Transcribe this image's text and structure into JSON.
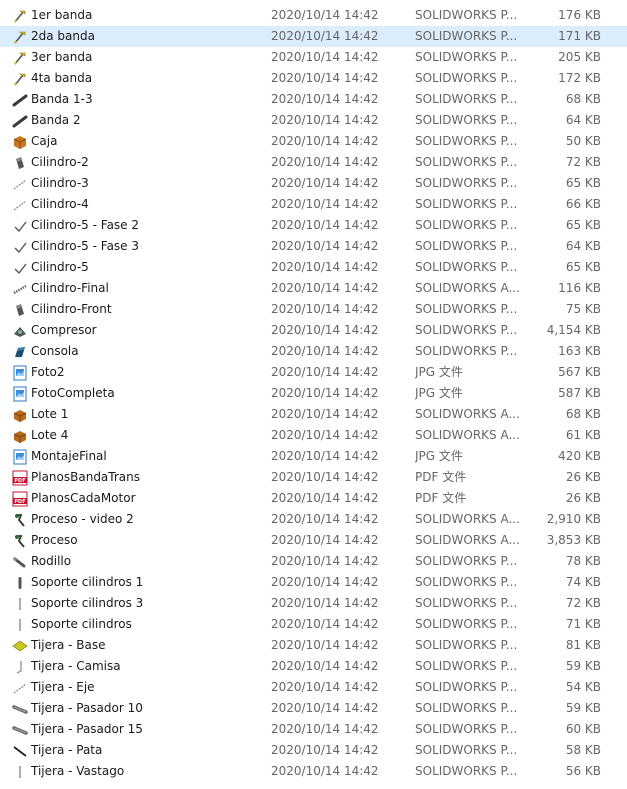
{
  "files": [
    {
      "name": "1er banda",
      "date": "2020/10/14 14:42",
      "type": "SOLIDWORKS P...",
      "size": "176 KB",
      "icon": "part-yellow-icon"
    },
    {
      "name": "2da banda",
      "date": "2020/10/14 14:42",
      "type": "SOLIDWORKS P...",
      "size": "171 KB",
      "icon": "part-yellow-icon",
      "selected": true
    },
    {
      "name": "3er banda",
      "date": "2020/10/14 14:42",
      "type": "SOLIDWORKS P...",
      "size": "205 KB",
      "icon": "part-yellow-icon"
    },
    {
      "name": "4ta banda",
      "date": "2020/10/14 14:42",
      "type": "SOLIDWORKS P...",
      "size": "172 KB",
      "icon": "part-yellow-icon"
    },
    {
      "name": "Banda 1-3",
      "date": "2020/10/14 14:42",
      "type": "SOLIDWORKS P...",
      "size": "68 KB",
      "icon": "part-bar-icon"
    },
    {
      "name": "Banda 2",
      "date": "2020/10/14 14:42",
      "type": "SOLIDWORKS P...",
      "size": "64 KB",
      "icon": "part-bar-icon"
    },
    {
      "name": "Caja",
      "date": "2020/10/14 14:42",
      "type": "SOLIDWORKS P...",
      "size": "50 KB",
      "icon": "part-box-icon"
    },
    {
      "name": "Cilindro-2",
      "date": "2020/10/14 14:42",
      "type": "SOLIDWORKS P...",
      "size": "72 KB",
      "icon": "part-cylinder-icon"
    },
    {
      "name": "Cilindro-3",
      "date": "2020/10/14 14:42",
      "type": "SOLIDWORKS P...",
      "size": "65 KB",
      "icon": "part-line-icon"
    },
    {
      "name": "Cilindro-4",
      "date": "2020/10/14 14:42",
      "type": "SOLIDWORKS P...",
      "size": "66 KB",
      "icon": "part-line-icon"
    },
    {
      "name": "Cilindro-5 - Fase 2",
      "date": "2020/10/14 14:42",
      "type": "SOLIDWORKS P...",
      "size": "65 KB",
      "icon": "part-angle-icon"
    },
    {
      "name": "Cilindro-5 - Fase 3",
      "date": "2020/10/14 14:42",
      "type": "SOLIDWORKS P...",
      "size": "64 KB",
      "icon": "part-angle-icon"
    },
    {
      "name": "Cilindro-5",
      "date": "2020/10/14 14:42",
      "type": "SOLIDWORKS P...",
      "size": "65 KB",
      "icon": "part-angle-icon"
    },
    {
      "name": "Cilindro-Final",
      "date": "2020/10/14 14:42",
      "type": "SOLIDWORKS A...",
      "size": "116 KB",
      "icon": "assembly-line-icon"
    },
    {
      "name": "Cilindro-Front",
      "date": "2020/10/14 14:42",
      "type": "SOLIDWORKS P...",
      "size": "75 KB",
      "icon": "part-cylinder-icon"
    },
    {
      "name": "Compresor",
      "date": "2020/10/14 14:42",
      "type": "SOLIDWORKS P...",
      "size": "4,154 KB",
      "icon": "part-machine-icon"
    },
    {
      "name": "Consola",
      "date": "2020/10/14 14:42",
      "type": "SOLIDWORKS P...",
      "size": "163 KB",
      "icon": "part-console-icon"
    },
    {
      "name": "Foto2",
      "date": "2020/10/14 14:42",
      "type": "JPG 文件",
      "size": "567 KB",
      "icon": "jpg-image-icon"
    },
    {
      "name": "FotoCompleta",
      "date": "2020/10/14 14:42",
      "type": "JPG 文件",
      "size": "587 KB",
      "icon": "jpg-image-icon"
    },
    {
      "name": "Lote 1",
      "date": "2020/10/14 14:42",
      "type": "SOLIDWORKS A...",
      "size": "68 KB",
      "icon": "assembly-box-icon"
    },
    {
      "name": "Lote 4",
      "date": "2020/10/14 14:42",
      "type": "SOLIDWORKS A...",
      "size": "61 KB",
      "icon": "assembly-box-icon"
    },
    {
      "name": "MontajeFinal",
      "date": "2020/10/14 14:42",
      "type": "JPG 文件",
      "size": "420 KB",
      "icon": "jpg-image-icon"
    },
    {
      "name": "PlanosBandaTrans",
      "date": "2020/10/14 14:42",
      "type": "PDF 文件",
      "size": "26 KB",
      "icon": "pdf-icon"
    },
    {
      "name": "PlanosCadaMotor",
      "date": "2020/10/14 14:42",
      "type": "PDF 文件",
      "size": "26 KB",
      "icon": "pdf-icon"
    },
    {
      "name": "Proceso - video 2",
      "date": "2020/10/14 14:42",
      "type": "SOLIDWORKS A...",
      "size": "2,910 KB",
      "icon": "assembly-process-icon"
    },
    {
      "name": "Proceso",
      "date": "2020/10/14 14:42",
      "type": "SOLIDWORKS A...",
      "size": "3,853 KB",
      "icon": "assembly-process-icon"
    },
    {
      "name": "Rodillo",
      "date": "2020/10/14 14:42",
      "type": "SOLIDWORKS P...",
      "size": "78 KB",
      "icon": "part-roller-icon"
    },
    {
      "name": "Soporte cilindros 1",
      "date": "2020/10/14 14:42",
      "type": "SOLIDWORKS P...",
      "size": "74 KB",
      "icon": "part-support-icon"
    },
    {
      "name": "Soporte cilindros 3",
      "date": "2020/10/14 14:42",
      "type": "SOLIDWORKS P...",
      "size": "72 KB",
      "icon": "part-thin-icon"
    },
    {
      "name": "Soporte cilindros",
      "date": "2020/10/14 14:42",
      "type": "SOLIDWORKS P...",
      "size": "71 KB",
      "icon": "part-thin-icon"
    },
    {
      "name": "Tijera - Base",
      "date": "2020/10/14 14:42",
      "type": "SOLIDWORKS P...",
      "size": "81 KB",
      "icon": "part-base-icon"
    },
    {
      "name": "Tijera - Camisa",
      "date": "2020/10/14 14:42",
      "type": "SOLIDWORKS P...",
      "size": "59 KB",
      "icon": "part-sleeve-icon"
    },
    {
      "name": "Tijera - Eje",
      "date": "2020/10/14 14:42",
      "type": "SOLIDWORKS P...",
      "size": "54 KB",
      "icon": "part-line-icon"
    },
    {
      "name": "Tijera - Pasador 10",
      "date": "2020/10/14 14:42",
      "type": "SOLIDWORKS P...",
      "size": "59 KB",
      "icon": "part-pin-icon"
    },
    {
      "name": "Tijera - Pasador 15",
      "date": "2020/10/14 14:42",
      "type": "SOLIDWORKS P...",
      "size": "60 KB",
      "icon": "part-pin-icon"
    },
    {
      "name": "Tijera - Pata",
      "date": "2020/10/14 14:42",
      "type": "SOLIDWORKS P...",
      "size": "58 KB",
      "icon": "part-leg-icon"
    },
    {
      "name": "Tijera - Vastago",
      "date": "2020/10/14 14:42",
      "type": "SOLIDWORKS P...",
      "size": "56 KB",
      "icon": "part-thin-icon"
    }
  ],
  "colors": {
    "selection": "#dbecfb",
    "meta_text": "#666666",
    "name_text": "#1a1a1a"
  }
}
